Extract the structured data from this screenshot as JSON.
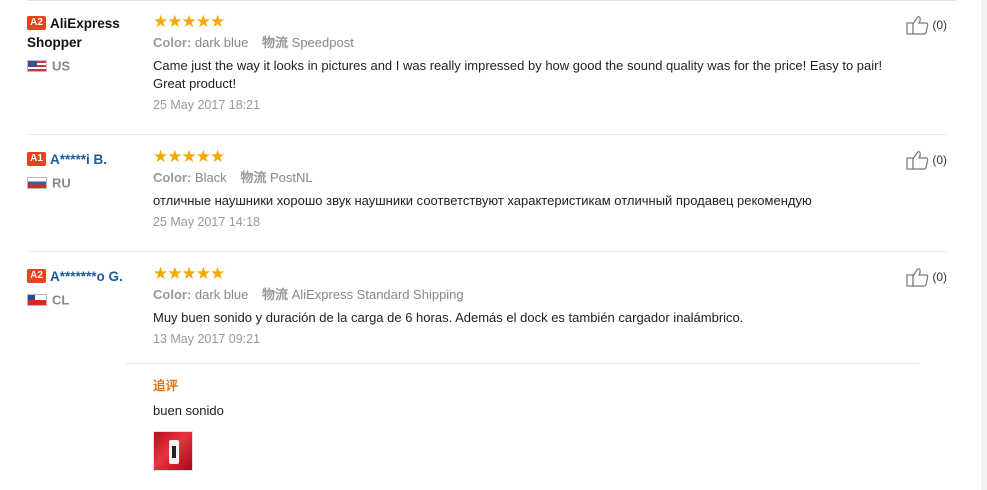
{
  "reviews": [
    {
      "level": "A2",
      "username": "AliExpress Shopper",
      "country": "US",
      "stars": "★★★★★",
      "color_label": "Color:",
      "color_value": "dark blue",
      "shipping_label": "物流",
      "shipping_value": "Speedpost",
      "text": "Came just the way it looks in pictures and I was really impressed by how good the sound quality was for the price! Easy to pair! Great product!",
      "date": "25 May 2017 18:21",
      "helpful_count": "(0)"
    },
    {
      "level": "A1",
      "username": "A*****i B.",
      "country": "RU",
      "stars": "★★★★★",
      "color_label": "Color:",
      "color_value": "Black",
      "shipping_label": "物流",
      "shipping_value": "PostNL",
      "text": "отличные наушники хорошо звук наушники соответствуют характеристикам отличный продавец рекомендую",
      "date": "25 May 2017 14:18",
      "helpful_count": "(0)"
    },
    {
      "level": "A2",
      "username": "A*******o G.",
      "country": "CL",
      "stars": "★★★★★",
      "color_label": "Color:",
      "color_value": "dark blue",
      "shipping_label": "物流",
      "shipping_value": "AliExpress Standard Shipping",
      "text": "Muy buen sonido y duración de la carga de 6 horas. Además el dock es también cargador inalámbrico.",
      "date": "13 May 2017 09:21",
      "helpful_count": "(0)",
      "additional_label": "追评",
      "additional_text": "buen sonido"
    }
  ],
  "icons": {
    "helpful": "thumbs-up-icon",
    "flag_us": "us-flag-icon",
    "flag_ru": "ru-flag-icon",
    "flag_cl": "cl-flag-icon"
  },
  "colors": {
    "star": "#f2a900",
    "level_badge": "#e8421c",
    "username_link": "#1a5b9a",
    "additional_label": "#e6731a"
  }
}
